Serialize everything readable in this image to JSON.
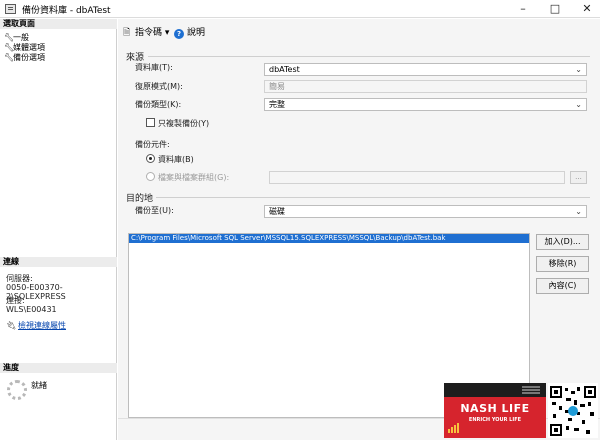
{
  "window": {
    "title": "備份資料庫 - dbATest",
    "min_icon": "minimize-icon",
    "max_icon": "maximize-icon",
    "close_icon": "close-icon"
  },
  "left_panel": {
    "pages_header": "選取頁面",
    "pages": [
      {
        "label": "一般"
      },
      {
        "label": "媒體選項"
      },
      {
        "label": "備份選項"
      }
    ],
    "connection_header": "連線",
    "server_label": "伺服器:",
    "server_value": "0050-E00370-2\\SQLEXPRESS",
    "connection_label": "連接:",
    "connection_value": "WLS\\E00431",
    "view_connection_props": "檢視連線屬性",
    "progress_header": "進度",
    "progress_status": "就緒"
  },
  "toolbar": {
    "script_label": "指令碼",
    "help_label": "說明"
  },
  "source": {
    "section_title": "來源",
    "database_label": "資料庫(T):",
    "database_value": "dbATest",
    "recovery_label": "復原模式(M):",
    "recovery_value": "簡易",
    "backup_type_label": "備份類型(K):",
    "backup_type_value": "完整",
    "copy_only_label": "只複製備份(Y)",
    "component_label": "備份元件:",
    "component_database": "資料庫(B)",
    "component_files": "檔案與檔案群組(G):",
    "files_value": "",
    "browse_label": "..."
  },
  "destination": {
    "section_title": "目的地",
    "backup_to_label": "備份至(U):",
    "backup_to_value": "磁碟",
    "files": [
      "C:\\Program Files\\Microsoft SQL Server\\MSSQL15.SQLEXPRESS\\MSSQL\\Backup\\dbATest.bak"
    ],
    "add_button": "加入(D)...",
    "remove_button": "移除(R)",
    "contents_button": "內容(C)"
  },
  "watermark": {
    "name": "NASH LIFE",
    "tagline": "ENRICH YOUR LIFE"
  },
  "colors": {
    "selection": "#1f6fd1",
    "link": "#0645ad",
    "brand_red": "#d6242d"
  }
}
